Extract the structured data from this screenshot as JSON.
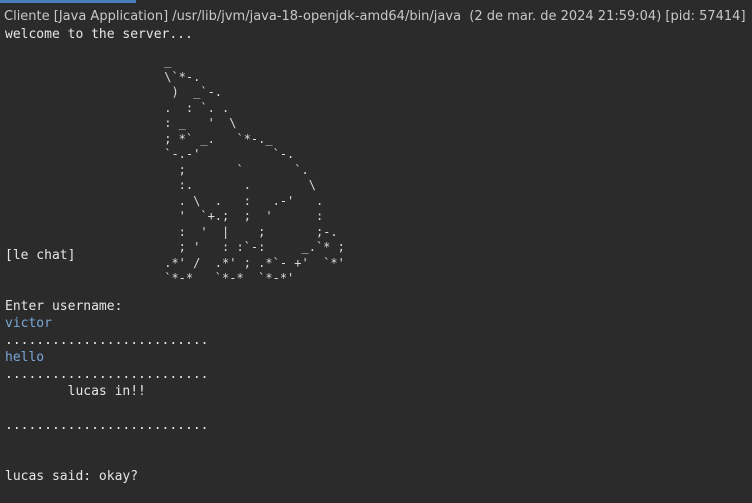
{
  "header": {
    "title": "Cliente [Java Application] /usr/lib/jvm/java-18-openjdk-amd64/bin/java  (2 de mar. de 2024 21:59:04) [pid: 57414]"
  },
  "console": {
    "welcome": "welcome to the server...",
    "ascii_art": " _\n \\`*-.\n  )  _`-.\n .  : `. .\n : _   '  \\\n ; *` _.   `*-._\n `-.-'          `-.\n   ;       `       `.\n   :.       .        \\\n   . \\  .   :   .-'   .\n   '  `+.;  ;  '      :\n   :  '  |    ;       ;-.\n   ; '   : :`-:     _.`* ;\n .*' /  .*' ; .*`- +'  `*'\n `*-*   `*-*  `*-*'",
    "room_label": "[le chat]",
    "prompt": "Enter username:",
    "username": "victor",
    "separator_1": "..........................",
    "message_1": "hello",
    "separator_2": "..........................",
    "join_notice": "        lucas in!!",
    "separator_3": "..........................",
    "chat_message": "lucas said: okay?"
  },
  "colors": {
    "background": "#2b2b2b",
    "output_text": "#e6e6e6",
    "user_input_text": "#7aa7d8",
    "header_text": "#c8c8c8"
  }
}
